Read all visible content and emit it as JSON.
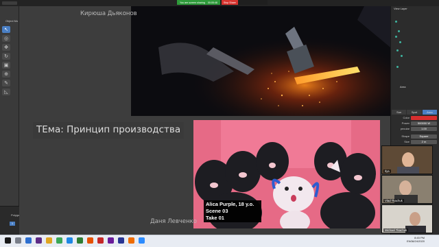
{
  "zoom_bar": {
    "sharing_text": "You are screen sharing",
    "timer": "00:05:48",
    "stop_label": "Stop Share"
  },
  "blender": {
    "object_mode": "Object Mo",
    "polygon_label": "Polygo",
    "frame": "1",
    "view_layer": "View Layer",
    "props_title": "Area",
    "tabs": [
      "Sun",
      "Spot",
      "Area"
    ],
    "rows": [
      {
        "label": "Color",
        "value": ""
      },
      {
        "label": "Power",
        "value": "500000 W"
      },
      {
        "label": "pecular",
        "value": "1.00"
      },
      {
        "label": "Shape",
        "value": "Square"
      },
      {
        "label": "Size",
        "value": "2 m"
      }
    ]
  },
  "main_tile": {
    "name": "Кирюша Дьяконов"
  },
  "topic": "ТЕма: Принцип производства",
  "bottom_tile": {
    "name": "Даня Левченко",
    "slate": [
      "Alica Purple, 18 y.o.",
      "Scene 03",
      "Take 01"
    ]
  },
  "side_tiles": [
    {
      "name": "Ilya"
    },
    {
      "name": "Vlad Tkachuk"
    },
    {
      "name": "Michael Tkachuk"
    }
  ],
  "taskbar": {
    "time": "8:45 PM",
    "date": "6/24/2020",
    "lang": "ENG"
  },
  "colors": {
    "sun_tab": "#4a7fc4",
    "color_swatch": "#d82e2e",
    "share_green": "#2e9a3a",
    "stop_red": "#d8342f"
  }
}
